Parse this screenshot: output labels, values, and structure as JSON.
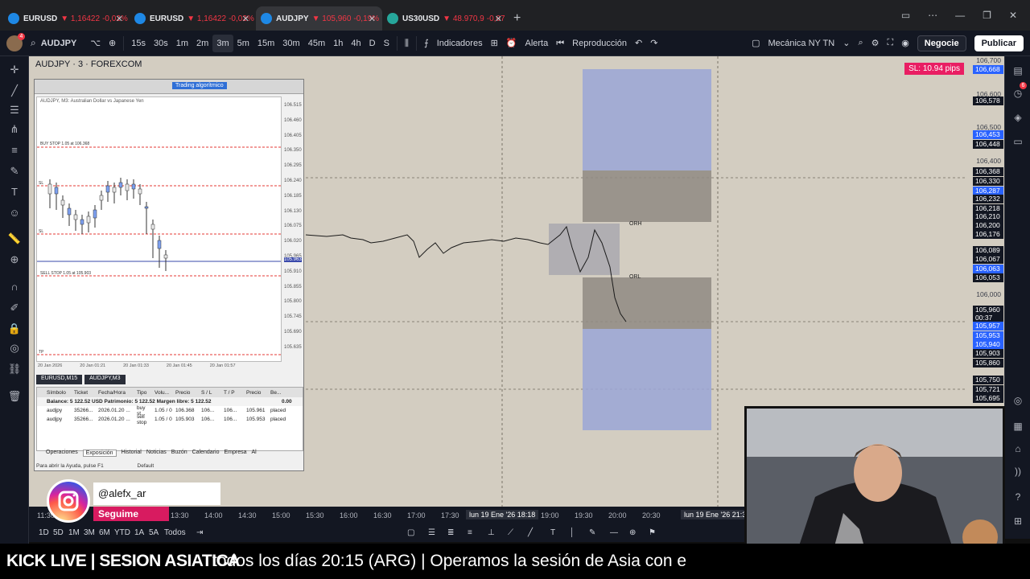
{
  "browser": {
    "tabs": [
      {
        "symbol": "EURUSD",
        "price": "▼ 1,16422",
        "change": "-0,02%",
        "fav_color": "#1e88e5"
      },
      {
        "symbol": "EURUSD",
        "price": "▼ 1,16422",
        "change": "-0,02%",
        "fav_color": "#1e88e5"
      },
      {
        "symbol": "AUDJPY",
        "price": "▼ 105,960",
        "change": "-0,19%",
        "fav_color": "#1e88e5"
      },
      {
        "symbol": "US30USD",
        "price": "▼ 48.970,9",
        "change": "-0,07",
        "fav_color": "#26a69a"
      }
    ],
    "new_tab": "+"
  },
  "toolbar": {
    "symbol": "AUDJPY",
    "avatar_badge": "4",
    "intervals": [
      "15s",
      "30s",
      "1m",
      "2m",
      "3m",
      "5m",
      "15m",
      "30m",
      "45m",
      "1h",
      "4h",
      "D",
      "S"
    ],
    "selected_interval": "3m",
    "indicators": "Indicadores",
    "alert": "Alerta",
    "replay": "Reproducción",
    "layout_name": "Mecánica NY TN",
    "trade_button": "Negocie",
    "publish_button": "Publicar"
  },
  "chart": {
    "title": "AUDJPY · 3 · FOREXCOM",
    "sl_badge": "SL: 10.94 pips",
    "levels": {
      "orh": "ORH",
      "orl": "ORL"
    },
    "price_ticks": [
      "106,700",
      "106,600",
      "106,500",
      "106,400",
      "106,300",
      "106,200",
      "106,100",
      "106,000",
      "105,900",
      "105,800"
    ],
    "price_boxes": [
      {
        "value": "106,668",
        "color": "blue"
      },
      {
        "value": "106,578",
        "color": "dark"
      },
      {
        "value": "106,453",
        "color": "blue"
      },
      {
        "value": "106,448",
        "color": "dark"
      },
      {
        "value": "106,368",
        "color": "dark"
      },
      {
        "value": "106,330",
        "color": "dark"
      },
      {
        "value": "106,287",
        "color": "blue"
      },
      {
        "value": "106,232",
        "color": "dark"
      },
      {
        "value": "106,218",
        "color": "dark"
      },
      {
        "value": "106,210",
        "color": "dark"
      },
      {
        "value": "106,200",
        "color": "dark"
      },
      {
        "value": "106,176",
        "color": "dark"
      },
      {
        "value": "106,089",
        "color": "dark"
      },
      {
        "value": "106,067",
        "color": "dark"
      },
      {
        "value": "106,063",
        "color": "blue"
      },
      {
        "value": "106,053",
        "color": "dark"
      },
      {
        "value": "105,960",
        "color": "dark"
      },
      {
        "value": "00:37",
        "color": "dark"
      },
      {
        "value": "105,957",
        "color": "blue"
      },
      {
        "value": "105,953",
        "color": "blue"
      },
      {
        "value": "105,940",
        "color": "blue"
      },
      {
        "value": "105,903",
        "color": "dark"
      },
      {
        "value": "105,860",
        "color": "dark"
      },
      {
        "value": "105,750",
        "color": "dark"
      },
      {
        "value": "105,721",
        "color": "dark"
      },
      {
        "value": "105,695",
        "color": "dark"
      }
    ],
    "time_ticks": [
      "11:30",
      "13:30",
      "14:00",
      "14:30",
      "15:00",
      "15:30",
      "16:00",
      "16:30",
      "17:00",
      "17:30",
      "19:00",
      "19:30",
      "20:00",
      "20:30"
    ],
    "time_cursor_1": "lun 19 Ene '26   18:18",
    "time_cursor_2": "lun 19 Ene '26   21:3"
  },
  "mt4": {
    "algo_button": "Trading algorítmico",
    "chart_title": "AUDJPY, M3: Australian Dollar vs Japanese Yen",
    "buy_stop_label": "BUY STOP 1.05 at 106.368",
    "sell_stop_label": "SELL STOP 1.05 at 105.903",
    "sl_label": "SL",
    "tp_label": "TP",
    "prices": [
      "106.515",
      "106.460",
      "106.405",
      "106.350",
      "106.295",
      "106.240",
      "106.185",
      "106.130",
      "106.075",
      "106.020",
      "105.965",
      "105.910",
      "105.855",
      "105.800",
      "105.745",
      "105.690",
      "105.635"
    ],
    "current_price": "105.963",
    "time_labels": [
      "20 Jan 2026",
      "20 Jan 01:21",
      "20 Jan 01:33",
      "20 Jan 01:45",
      "20 Jan 01:57"
    ],
    "chart_tabs": [
      "EURUSD,M15",
      "AUDJPY,M3"
    ],
    "columns": [
      "Símbolo",
      "Ticket",
      "Fecha/Hora",
      "Tipo",
      "Volu...",
      "Precio",
      "S / L",
      "T / P",
      "Precio",
      "Be..."
    ],
    "balance_row": "Balance: 5 122.52 USD  Patrimonio: 5 122.52  Margen libre: 5 122.52",
    "balance_value": "0.00",
    "orders": [
      [
        "audjpy",
        "35266...",
        "2026.01.20 ...",
        "buy st...",
        "1.05 / 0",
        "106.368",
        "106...",
        "106...",
        "105.961",
        "placed"
      ],
      [
        "audjpy",
        "35266...",
        "2026.01.20 ...",
        "sell stop",
        "1.05 / 0",
        "105.903",
        "106...",
        "106...",
        "105.953",
        "placed"
      ]
    ],
    "terminal_tabs": [
      "Operaciones",
      "Exposición",
      "Historial",
      "Noticias",
      "Buzón",
      "Calendario",
      "Empresa",
      "Al"
    ],
    "active_terminal_tab": "Exposición",
    "side_label": "Caja de Herramientas",
    "status_left": "Para abrir la Ayuda, pulse F1",
    "status_mid": "Default"
  },
  "bottom_toolbar": {
    "ranges": [
      "1D",
      "5D",
      "1M",
      "3M",
      "6M",
      "YTD",
      "1A",
      "5A",
      "Todos"
    ]
  },
  "instagram": {
    "handle": "@alefx_ar",
    "follow": "Seguime"
  },
  "ticker": {
    "title": "KICK LIVE | SESION ASIATICA",
    "message": "todos los días 20:15 (ARG) | Operamos la sesión de Asia con e"
  }
}
